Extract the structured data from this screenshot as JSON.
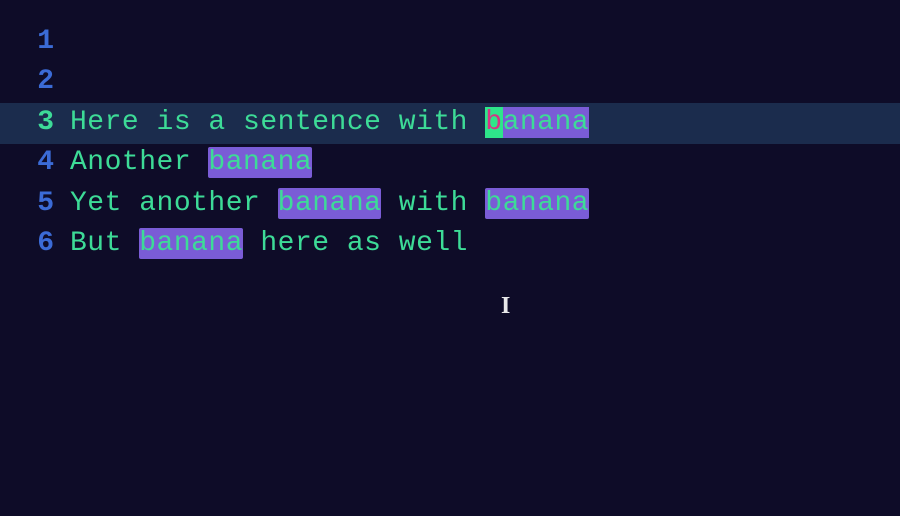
{
  "editor": {
    "lines": [
      {
        "num": "1",
        "segments": []
      },
      {
        "num": "2",
        "segments": []
      },
      {
        "num": "3",
        "current": true,
        "segments": [
          {
            "t": "Here is a sentence with "
          },
          {
            "t": "b",
            "cls": "cursor"
          },
          {
            "t": "anana",
            "cls": "partial-hl"
          }
        ]
      },
      {
        "num": "4",
        "segments": [
          {
            "t": "Another "
          },
          {
            "t": "banana",
            "cls": "hl"
          }
        ]
      },
      {
        "num": "5",
        "segments": [
          {
            "t": "Yet another "
          },
          {
            "t": "banana",
            "cls": "hl"
          },
          {
            "t": " with "
          },
          {
            "t": "banana",
            "cls": "hl"
          }
        ]
      },
      {
        "num": "6",
        "segments": [
          {
            "t": "But "
          },
          {
            "t": "banana",
            "cls": "hl"
          },
          {
            "t": " here as well"
          }
        ]
      }
    ],
    "cursor_icon": "I",
    "search_term": "banana"
  }
}
